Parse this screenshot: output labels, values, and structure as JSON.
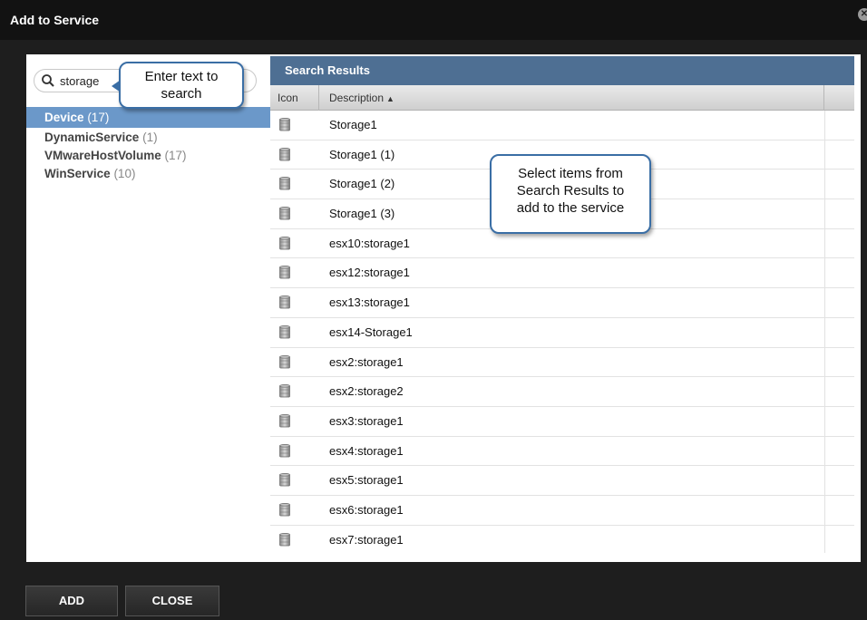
{
  "dialog": {
    "title": "Add to Service",
    "close_symbol": "✕"
  },
  "search": {
    "value": "storage",
    "icon": "search-icon"
  },
  "categories": [
    {
      "name": "Device",
      "count": "(17)",
      "selected": true
    },
    {
      "name": "DynamicService",
      "count": "(1)",
      "selected": false
    },
    {
      "name": "VMwareHostVolume",
      "count": "(17)",
      "selected": false
    },
    {
      "name": "WinService",
      "count": "(10)",
      "selected": false
    }
  ],
  "results": {
    "header": "Search Results",
    "columns": {
      "icon": "Icon",
      "description": "Description",
      "sort_indicator": "▲"
    },
    "row_icon": "storage-icon",
    "rows": [
      "Storage1",
      "Storage1 (1)",
      "Storage1 (2)",
      "Storage1 (3)",
      "esx10:storage1",
      "esx12:storage1",
      "esx13:storage1",
      "esx14-Storage1",
      "esx2:storage1",
      "esx2:storage2",
      "esx3:storage1",
      "esx4:storage1",
      "esx5:storage1",
      "esx6:storage1",
      "esx7:storage1"
    ]
  },
  "callouts": {
    "search_line1": "Enter text to",
    "search_line2": "search",
    "select_line1": "Select items from",
    "select_line2": "Search Results to",
    "select_line3": "add to the service"
  },
  "buttons": {
    "add": "ADD",
    "close": "CLOSE"
  },
  "colors": {
    "selected_row": "#6b98c9",
    "results_header": "#4e6f93",
    "callout_border": "#3a6ea5"
  }
}
